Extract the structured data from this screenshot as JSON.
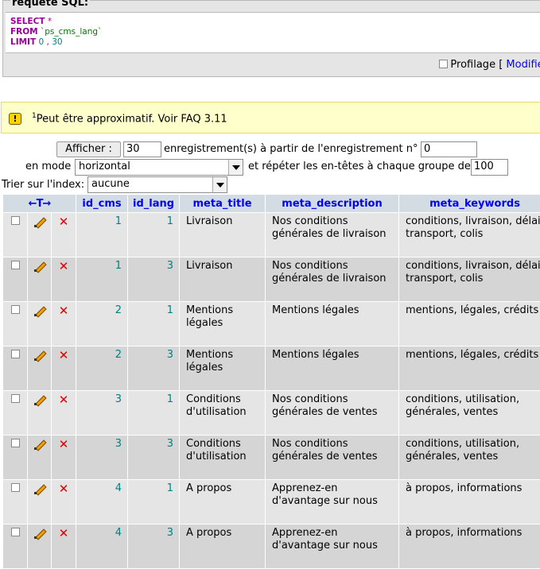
{
  "sql": {
    "legend": "requête SQL:",
    "line1_kw": "SELECT",
    "line1_rest": "*",
    "line2_kw": "FROM",
    "line2_table": "`ps_cms_lang`",
    "line3_kw": "LIMIT",
    "line3_a": "0",
    "line3_sep": ",",
    "line3_b": "30",
    "profilage_label": "Profilage [",
    "modifier_link": "Modifier"
  },
  "notice": {
    "icon_name": "warning-icon",
    "sup": "1",
    "text": "Peut être approximatif. Voir FAQ 3.11"
  },
  "nav": {
    "show_button": "Afficher :",
    "rows_value": "30",
    "from_label": "enregistrement(s) à partir de l'enregistrement n°",
    "start_value": "0",
    "mode_label": "en mode",
    "mode_value": "horizontal",
    "repeat_label": "et répéter les en-têtes à chaque groupe de",
    "repeat_value": "100",
    "sort_label": "Trier sur l'index:",
    "sort_value": "aucune"
  },
  "table": {
    "columns": [
      "id_cms",
      "id_lang",
      "meta_title",
      "meta_description",
      "meta_keywords"
    ],
    "rows": [
      {
        "id_cms": "1",
        "id_lang": "1",
        "meta_title": "Livraison",
        "meta_description": "Nos conditions générales de livraison",
        "meta_keywords": "conditions, livraison, délais, transport, colis"
      },
      {
        "id_cms": "1",
        "id_lang": "3",
        "meta_title": "Livraison",
        "meta_description": "Nos conditions générales de livraison",
        "meta_keywords": "conditions, livraison, délais, transport, colis"
      },
      {
        "id_cms": "2",
        "id_lang": "1",
        "meta_title": "Mentions légales",
        "meta_description": "Mentions légales",
        "meta_keywords": "mentions, légales, crédits"
      },
      {
        "id_cms": "2",
        "id_lang": "3",
        "meta_title": "Mentions légales",
        "meta_description": "Mentions légales",
        "meta_keywords": "mentions, légales, crédits"
      },
      {
        "id_cms": "3",
        "id_lang": "1",
        "meta_title": "Conditions d'utilisation",
        "meta_description": "Nos conditions générales de ventes",
        "meta_keywords": "conditions, utilisation, générales, ventes"
      },
      {
        "id_cms": "3",
        "id_lang": "3",
        "meta_title": "Conditions d'utilisation",
        "meta_description": "Nos conditions générales de ventes",
        "meta_keywords": "conditions, utilisation, générales, ventes"
      },
      {
        "id_cms": "4",
        "id_lang": "1",
        "meta_title": "A propos",
        "meta_description": "Apprenez-en d'avantage sur nous",
        "meta_keywords": "à propos, informations"
      },
      {
        "id_cms": "4",
        "id_lang": "3",
        "meta_title": "A propos",
        "meta_description": "Apprenez-en d'avantage sur nous",
        "meta_keywords": "à propos, informations"
      }
    ]
  },
  "colors": {
    "header_bg": "#d3dce3",
    "row_odd": "#e5e5e5",
    "row_even": "#d5d5d5",
    "keyword": "#990099",
    "link": "#0000ff",
    "notice_bg": "#ffffcc"
  }
}
